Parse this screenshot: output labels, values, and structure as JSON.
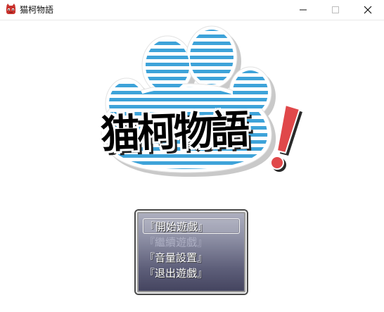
{
  "window": {
    "title": "猫柯物語",
    "icon": "app-red-cat-icon",
    "controls": [
      "minimize-icon",
      "maximize-icon",
      "close-icon"
    ]
  },
  "logo": {
    "text": "猫柯物語",
    "exclamation": "!",
    "colors": {
      "stripe_blue": "#3ea3d9",
      "exclaim_red": "#e0484a",
      "text": "#000000"
    }
  },
  "menu": {
    "items": [
      {
        "label": "『開始遊戲』",
        "state": "selected"
      },
      {
        "label": "『繼續遊戲』",
        "state": "disabled"
      },
      {
        "label": "『音量設置』",
        "state": "normal"
      },
      {
        "label": "『退出遊戲』",
        "state": "normal"
      }
    ]
  }
}
